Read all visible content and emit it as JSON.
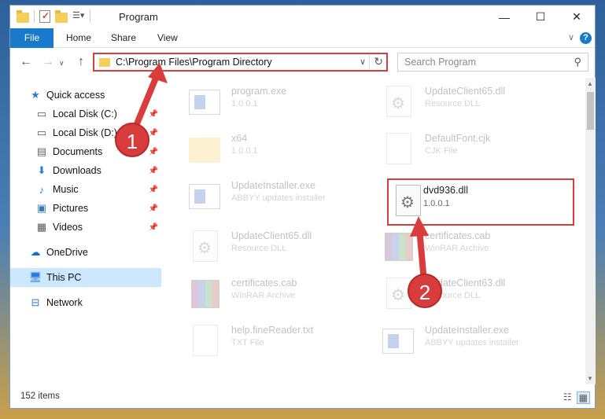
{
  "window": {
    "title": "Program"
  },
  "caption": {
    "minimize": "—",
    "maximize": "☐",
    "close": "✕"
  },
  "ribbon": {
    "tabs": [
      "File",
      "Home",
      "Share",
      "View"
    ],
    "help": "?"
  },
  "address": {
    "path": "C:\\Program Files\\Program Directory"
  },
  "search": {
    "placeholder": "Search Program"
  },
  "sidebar": {
    "items": [
      {
        "label": "Quick access",
        "icon": "star-icon",
        "pinned": false
      },
      {
        "label": "Local Disk (C:)",
        "icon": "drive-icon",
        "pinned": true
      },
      {
        "label": "Local Disk (D:)",
        "icon": "drive-icon",
        "pinned": true
      },
      {
        "label": "Documents",
        "icon": "documents-icon",
        "pinned": true
      },
      {
        "label": "Downloads",
        "icon": "download-icon",
        "pinned": true
      },
      {
        "label": "Music",
        "icon": "music-icon",
        "pinned": true
      },
      {
        "label": "Pictures",
        "icon": "pictures-icon",
        "pinned": true
      },
      {
        "label": "Videos",
        "icon": "videos-icon",
        "pinned": true
      },
      {
        "label": "OneDrive",
        "icon": "cloud-icon",
        "pinned": false
      },
      {
        "label": "This PC",
        "icon": "computer-icon",
        "pinned": false,
        "selected": true
      },
      {
        "label": "Network",
        "icon": "network-icon",
        "pinned": false
      }
    ]
  },
  "files": [
    {
      "name": "program.exe",
      "sub": "1.0.0.1",
      "type": "exe"
    },
    {
      "name": "UpdateClient65.dll",
      "sub": "Resource DLL",
      "type": "dll"
    },
    {
      "name": "x64",
      "sub": "1.0.0.1",
      "type": "folder"
    },
    {
      "name": "DefaultFont.cjk",
      "sub": "CJK File",
      "type": "txt"
    },
    {
      "name": "UpdateInstaller.exe",
      "sub": "ABBYY updates installer",
      "type": "exe"
    },
    {
      "name": "dvd936.dll",
      "sub": "1.0.0.1",
      "type": "dll",
      "highlighted": true
    },
    {
      "name": "UpdateClient65.dll",
      "sub": "Resource DLL",
      "type": "dll"
    },
    {
      "name": "certificates.cab",
      "sub": "WinRAR Archive",
      "type": "cab"
    },
    {
      "name": "certificates.cab",
      "sub": "WinRAR Archive",
      "type": "cab"
    },
    {
      "name": "UpdateClient63.dll",
      "sub": "Resource DLL",
      "type": "dll"
    },
    {
      "name": "help.fineReader.txt",
      "sub": "TXT File",
      "type": "txt"
    },
    {
      "name": "UpdateInstaller.exe",
      "sub": "ABBYY updates installer",
      "type": "exe"
    }
  ],
  "status": {
    "count": "152 items"
  },
  "annotations": {
    "badge1": "1",
    "badge2": "2",
    "color": "#d83c3c"
  }
}
